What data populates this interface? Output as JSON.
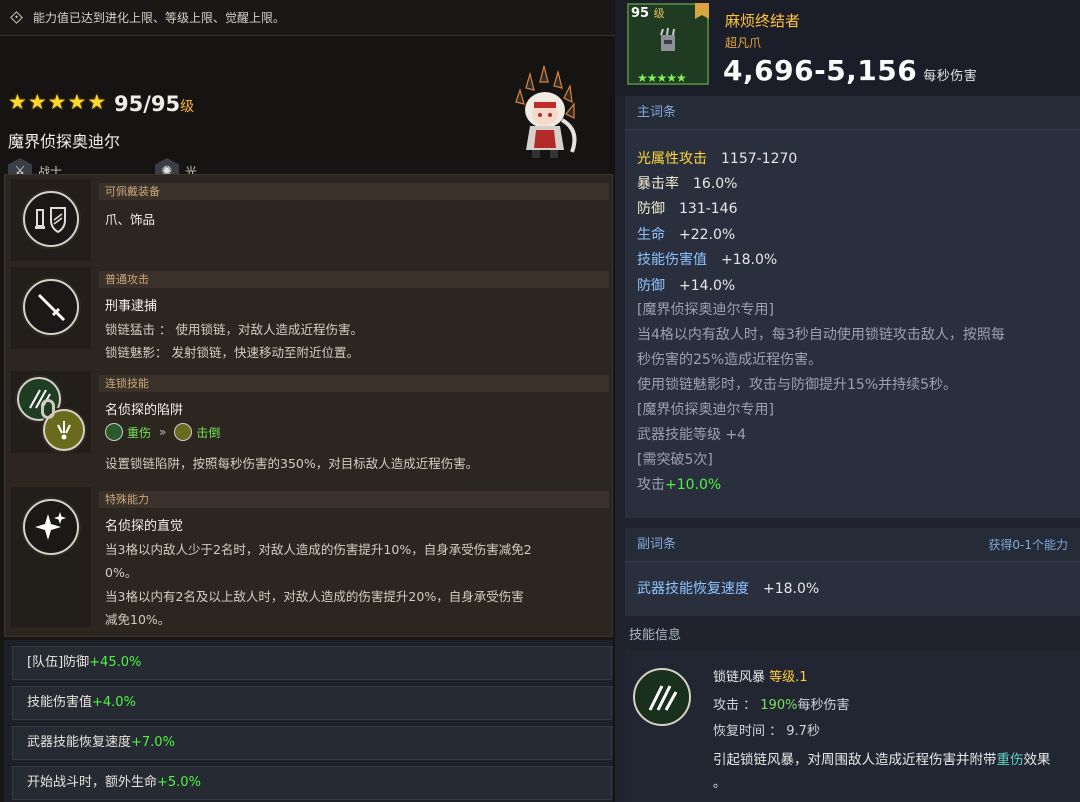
{
  "notice": "能力值已达到进化上限、等级上限、觉醒上限。",
  "hero": {
    "stars": 5,
    "level": "95/95",
    "level_unit": "级",
    "name": "魔界侦探奥迪尔",
    "role": "战士",
    "element": "光"
  },
  "equip": {
    "header": "可佩戴装备",
    "text": "爪、饰品"
  },
  "normal_attack": {
    "header": "普通攻击",
    "title": "刑事逮捕",
    "lines": [
      "锁链猛击 ： 使用锁链，对敌人造成近程伤害。",
      "锁链魅影： 发射锁链，快速移动至附近位置。"
    ]
  },
  "chain_skill": {
    "header": "连锁技能",
    "title": "名侦探的陷阱",
    "from": "重伤",
    "to": "击倒",
    "desc": "设置锁链陷阱，按照每秒伤害的350%，对目标敌人造成近程伤害。"
  },
  "special": {
    "header": "特殊能力",
    "title": "名侦探的直觉",
    "lines": [
      "当3格以内敌人少于2名时，对敌人造成的伤害提升10%，自身承受伤害减免2",
      "0%。",
      "当3格以内有2名及以上敌人时，对敌人造成的伤害提升20%，自身承受伤害",
      "减免10%。"
    ]
  },
  "buffs": [
    {
      "label": "[队伍]防御",
      "value": "+45.0%"
    },
    {
      "label": "技能伤害值",
      "value": "+4.0%"
    },
    {
      "label": "武器技能恢复速度",
      "value": "+7.0%"
    },
    {
      "label": "开始战斗时，额外生命",
      "value": "+5.0%"
    }
  ],
  "weapon": {
    "level": "95",
    "level_unit": "级",
    "stars": 5,
    "name": "麻烦终结者",
    "type": "超凡爪",
    "dps": "4,696-5,156",
    "dps_unit": "每秒伤害"
  },
  "main_stats_header": "主词条",
  "main_stats": [
    {
      "k": "光属性攻击",
      "v": "1157-1270",
      "style": "y"
    },
    {
      "k": "暴击率",
      "v": "16.0%",
      "style": ""
    },
    {
      "k": "防御",
      "v": "131-146",
      "style": ""
    },
    {
      "k": "生命",
      "v": "+22.0%",
      "style": "b"
    },
    {
      "k": "技能伤害值",
      "v": "+18.0%",
      "style": "b"
    },
    {
      "k": "防御",
      "v": "+14.0%",
      "style": "b"
    }
  ],
  "exclusive": {
    "tag1": "[魔界侦探奥迪尔专用]",
    "text1a": "当4格以内有敌人时，每3秒自动使用锁链攻击敌人，按照每",
    "text1b": "秒伤害的25%造成近程伤害。",
    "text2": "使用锁链魅影时，攻击与防御提升15%并持续5秒。",
    "tag2": "[魔界侦探奥迪尔专用]",
    "text3": "武器技能等级 +4",
    "tag3": "[需突破5次]",
    "text4_label": "攻击",
    "text4_value": "+10.0%"
  },
  "sub_stats": {
    "header": "副词条",
    "right": "获得0-1个能力",
    "k": "武器技能恢复速度",
    "v": "+18.0%"
  },
  "skill_info": {
    "header": "技能信息",
    "name": "锁链风暴",
    "level_label": "等级.1",
    "atk_label": "攻击 ：",
    "atk_pct": "190%",
    "atk_unit": "每秒伤害",
    "cd_label": "恢复时间 ：",
    "cd": "9.7秒",
    "desc_a": "引起锁链风暴，对周围敌人造成近程伤害并附带",
    "desc_hl": "重伤",
    "desc_b": "效果",
    "desc_end": "。"
  },
  "colors": {
    "green": "#4ff242",
    "gold": "#ffcc33",
    "blue_key": "#8ec4ff",
    "star": "#ffd92e"
  }
}
